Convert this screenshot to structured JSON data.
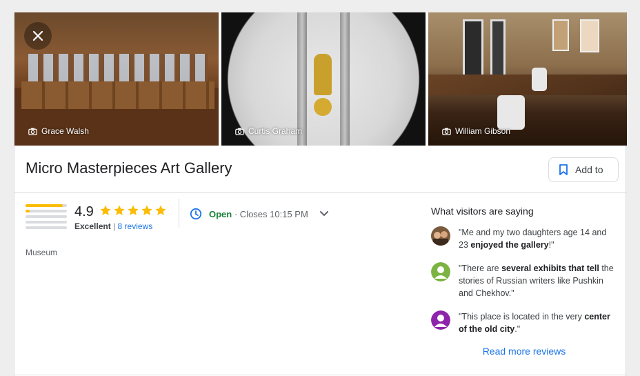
{
  "photos": [
    {
      "credit": "Grace Walsh"
    },
    {
      "credit": "Curtis Graham"
    },
    {
      "credit": "William Gibson"
    }
  ],
  "place": {
    "title": "Micro Masterpieces Art Gallery",
    "add_label": "Add to",
    "category": "Museum"
  },
  "rating": {
    "score": "4.9",
    "stars": 5,
    "label": "Excellent",
    "separator": "|",
    "reviews_link": "8 reviews",
    "distribution": [
      0.9,
      0.1,
      0.0,
      0.0,
      0.0
    ]
  },
  "hours": {
    "status": "Open",
    "detail": "· Closes 10:15 PM"
  },
  "visitors": {
    "heading": "What visitors are saying",
    "reviews": [
      {
        "pre": "\"Me and my two daughters age 14 and 23 ",
        "bold": "enjoyed the gallery",
        "post": "!\""
      },
      {
        "pre": "\"There are ",
        "bold": "several exhibits that tell",
        "post": " the stories of Russian writers like Pushkin and Chekhov.\""
      },
      {
        "pre": "\"This place is located in the very ",
        "bold": "center of the old city",
        "post": ".\""
      }
    ],
    "read_more": "Read more reviews"
  },
  "colors": {
    "accent": "#1a73e8",
    "star": "#fbbc04",
    "open": "#188038",
    "avatar_green": "#7cb342",
    "avatar_purple": "#8e24aa"
  }
}
